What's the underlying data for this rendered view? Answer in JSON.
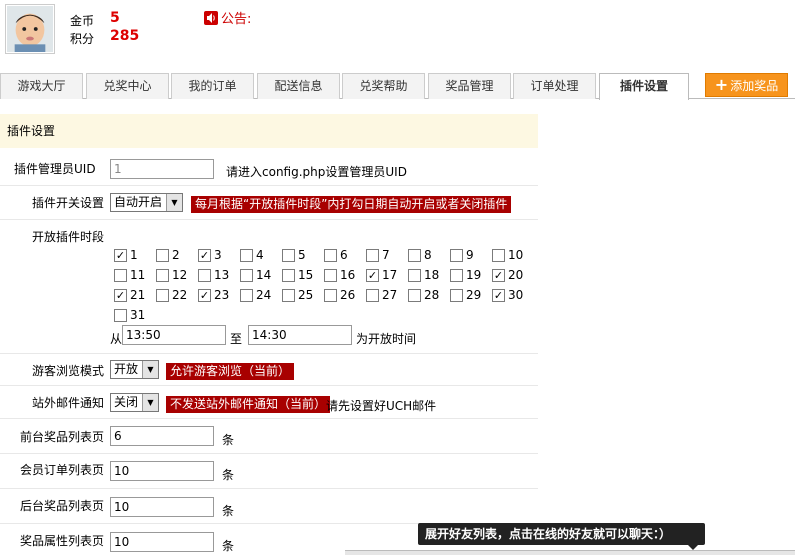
{
  "user": {
    "coin_label": "金币",
    "coin_value": "5",
    "points_label": "积分",
    "points_value": "285"
  },
  "notice": {
    "label": "公告:"
  },
  "tabs": [
    {
      "label": "游戏大厅"
    },
    {
      "label": "兑奖中心"
    },
    {
      "label": "我的订单"
    },
    {
      "label": "配送信息"
    },
    {
      "label": "兑奖帮助"
    },
    {
      "label": "奖品管理"
    },
    {
      "label": "订单处理"
    },
    {
      "label": "插件设置"
    }
  ],
  "add_button": "添加奖品",
  "section_title": "插件设置",
  "form": {
    "admin_uid": {
      "label": "插件管理员UID",
      "value": "1",
      "hint": "请进入config.php设置管理员UID"
    },
    "switch": {
      "label": "插件开关设置",
      "selected": "自动开启",
      "tag": "每月根据“开放插件时段”内打勾日期自动开启或者关闭插件"
    },
    "period": {
      "label": "开放插件时段",
      "days": [
        {
          "n": "1",
          "checked": true
        },
        {
          "n": "2",
          "checked": false
        },
        {
          "n": "3",
          "checked": true
        },
        {
          "n": "4",
          "checked": false
        },
        {
          "n": "5",
          "checked": false
        },
        {
          "n": "6",
          "checked": false
        },
        {
          "n": "7",
          "checked": false
        },
        {
          "n": "8",
          "checked": false
        },
        {
          "n": "9",
          "checked": false
        },
        {
          "n": "10",
          "checked": false
        },
        {
          "n": "11",
          "checked": false
        },
        {
          "n": "12",
          "checked": false
        },
        {
          "n": "13",
          "checked": false
        },
        {
          "n": "14",
          "checked": false
        },
        {
          "n": "15",
          "checked": false
        },
        {
          "n": "16",
          "checked": false
        },
        {
          "n": "17",
          "checked": true
        },
        {
          "n": "18",
          "checked": false
        },
        {
          "n": "19",
          "checked": false
        },
        {
          "n": "20",
          "checked": true
        },
        {
          "n": "21",
          "checked": true
        },
        {
          "n": "22",
          "checked": false
        },
        {
          "n": "23",
          "checked": true
        },
        {
          "n": "24",
          "checked": false
        },
        {
          "n": "25",
          "checked": false
        },
        {
          "n": "26",
          "checked": false
        },
        {
          "n": "27",
          "checked": false
        },
        {
          "n": "28",
          "checked": false
        },
        {
          "n": "29",
          "checked": false
        },
        {
          "n": "30",
          "checked": true
        },
        {
          "n": "31",
          "checked": false
        }
      ],
      "from_label": "从",
      "from_value": "13:50",
      "to_label": "至",
      "to_value": "14:30",
      "suffix": "为开放时间"
    },
    "guest": {
      "label": "游客浏览模式",
      "selected": "开放",
      "tag": "允许游客浏览（当前）"
    },
    "mail": {
      "label": "站外邮件通知",
      "selected": "关闭",
      "tag": "不发送站外邮件通知（当前）",
      "hint": "请先设置好UCH邮件"
    },
    "front_list": {
      "label": "前台奖品列表页",
      "value": "6",
      "unit": "条"
    },
    "member_orders": {
      "label": "会员订单列表页",
      "value": "10",
      "unit": "条"
    },
    "back_list": {
      "label": "后台奖品列表页",
      "value": "10",
      "unit": "条"
    },
    "attr_list": {
      "label": "奖品属性列表页",
      "value": "10",
      "unit": "条"
    }
  },
  "chat_bar": "展开好友列表，点击在线的好友就可以聊天：）"
}
